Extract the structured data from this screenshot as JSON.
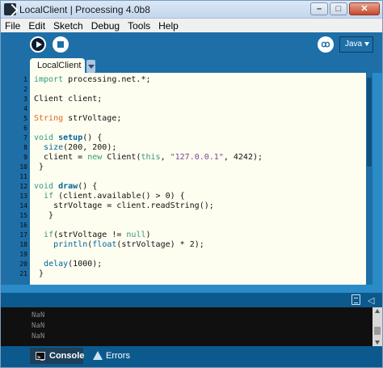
{
  "window": {
    "title": "LocalClient | Processing 4.0b8",
    "minimize_glyph": "–",
    "maximize_glyph": "□",
    "close_glyph": "✕"
  },
  "menu": [
    "File",
    "Edit",
    "Sketch",
    "Debug",
    "Tools",
    "Help"
  ],
  "toolbar": {
    "run_icon": "play-icon",
    "stop_icon": "stop-icon",
    "debug_icon": "debugger-icon",
    "mode": "Java"
  },
  "tab": {
    "label": "LocalClient"
  },
  "editor": {
    "line_numbers": [
      "1",
      "2",
      "3",
      "4",
      "5",
      "6",
      "7",
      "8",
      "9",
      "10",
      "11",
      "12",
      "13",
      "14",
      "15",
      "16",
      "17",
      "18",
      "19",
      "20",
      "21"
    ]
  },
  "console": {
    "lines": [
      "NaN",
      "NaN",
      "NaN"
    ]
  },
  "bottom_tabs": {
    "console": "Console",
    "errors": "Errors"
  },
  "colors": {
    "accent": "#1e6fa7",
    "editor_bg": "#fdfdf0",
    "keyword": "#33997e",
    "function": "#006699",
    "string": "#7d4793",
    "type": "#e2661a"
  }
}
